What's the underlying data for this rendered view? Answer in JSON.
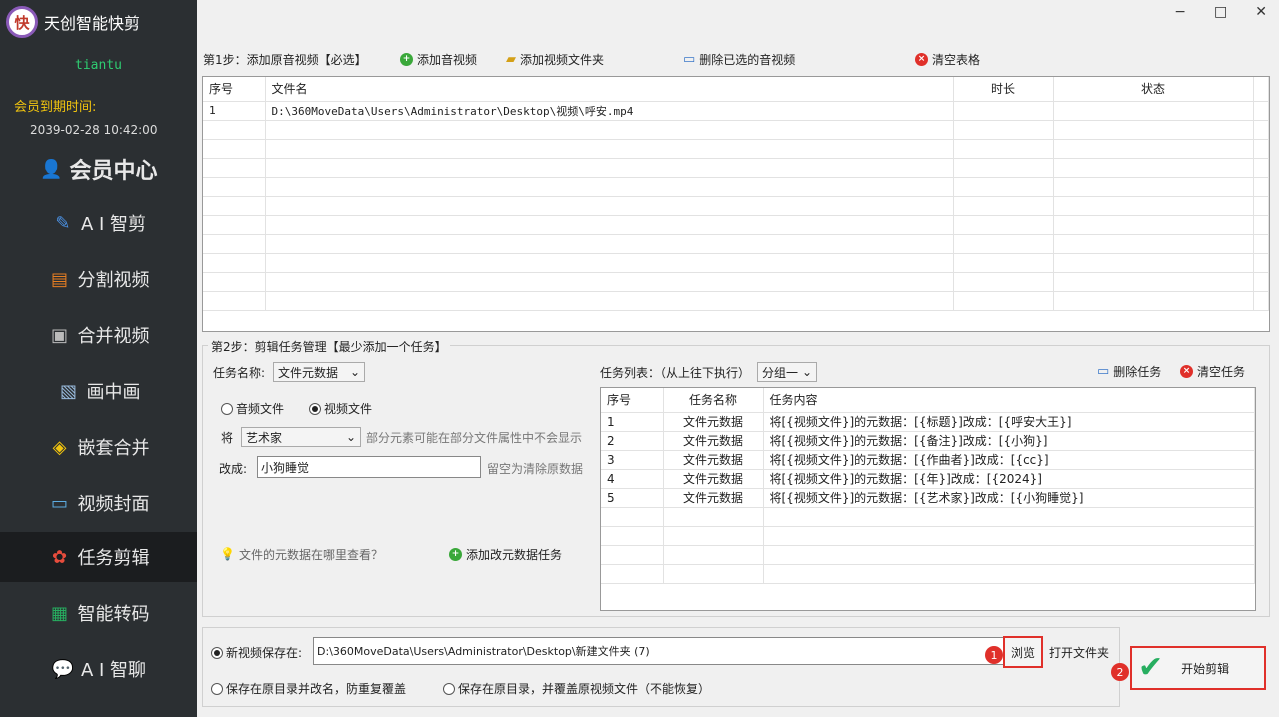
{
  "sidebar": {
    "app_title": "天创智能快剪",
    "logo_char": "快",
    "username": "tiantu",
    "expire_label": "会员到期时间:",
    "expire_date": "2039-02-28 10:42:00",
    "vip_center": "会员中心",
    "items": [
      {
        "label": "A I 智剪",
        "icon": "ai-icon"
      },
      {
        "label": "分割视频",
        "icon": "split-icon"
      },
      {
        "label": "合并视频",
        "icon": "merge-icon"
      },
      {
        "label": "画中画",
        "icon": "pip-icon"
      },
      {
        "label": "嵌套合并",
        "icon": "nest-icon"
      },
      {
        "label": "视频封面",
        "icon": "cover-icon"
      },
      {
        "label": "任务剪辑",
        "icon": "flower-icon"
      },
      {
        "label": "智能转码",
        "icon": "transcode-icon"
      },
      {
        "label": "A I 智聊",
        "icon": "chat-icon"
      }
    ]
  },
  "window": {
    "minimize": "−",
    "maximize": "□",
    "close": "✕"
  },
  "step1": {
    "label": "第1步：添加原音视频【必选】",
    "add_audio_video": "添加音视频",
    "add_folder": "添加视频文件夹",
    "delete_selected": "删除已选的音视频",
    "clear_table": "清空表格",
    "columns": [
      "序号",
      "文件名",
      "时长",
      "状态"
    ],
    "rows": [
      {
        "no": "1",
        "file": "D:\\360MoveData\\Users\\Administrator\\Desktop\\视频\\呼安.mp4",
        "duration": "",
        "status": ""
      }
    ]
  },
  "step2": {
    "label": "第2步：剪辑任务管理【最少添加一个任务】",
    "task_name_label": "任务名称:",
    "task_name_value": "文件元数据",
    "radio_audio": "音频文件",
    "radio_video": "视频文件",
    "field_prefix": "将",
    "field_value": "艺术家",
    "field_hint": "部分元素可能在部分文件属性中不会显示",
    "change_label": "改成:",
    "change_value": "小狗睡觉",
    "change_hint": "留空为清除原数据",
    "meta_help": "文件的元数据在哪里查看？",
    "add_task_btn": "添加改元数据任务",
    "task_list_label": "任务列表：（从上往下执行）",
    "group_value": "分组一",
    "delete_task": "删除任务",
    "clear_tasks": "清空任务",
    "task_columns": [
      "序号",
      "任务名称",
      "任务内容"
    ],
    "tasks": [
      {
        "no": "1",
        "name": "文件元数据",
        "content": "将[{视频文件}]的元数据：[{标题}]改成：[{呼安大王}]"
      },
      {
        "no": "2",
        "name": "文件元数据",
        "content": "将[{视频文件}]的元数据：[{备注}]改成：[{小狗}]"
      },
      {
        "no": "3",
        "name": "文件元数据",
        "content": "将[{视频文件}]的元数据：[{作曲者}]改成：[{cc}]"
      },
      {
        "no": "4",
        "name": "文件元数据",
        "content": "将[{视频文件}]的元数据：[{年}]改成：[{2024}]"
      },
      {
        "no": "5",
        "name": "文件元数据",
        "content": "将[{视频文件}]的元数据：[{艺术家}]改成：[{小狗睡觉}]"
      }
    ]
  },
  "output": {
    "save_label": "新视频保存在:",
    "save_path": "D:\\360MoveData\\Users\\Administrator\\Desktop\\新建文件夹 (7)",
    "browse": "浏览",
    "open_folder": "打开文件夹",
    "opt_rename": "保存在原目录并改名，防重复覆盖",
    "opt_overwrite": "保存在原目录，并覆盖原视频文件（不能恢复）",
    "start": "开始剪辑",
    "badge1": "1",
    "badge2": "2"
  },
  "colors": {
    "sidebar_bg": "#2b2f32",
    "accent_red": "#e0302a",
    "username_green": "#2ecc71",
    "expire_yellow": "#f1c40f"
  }
}
